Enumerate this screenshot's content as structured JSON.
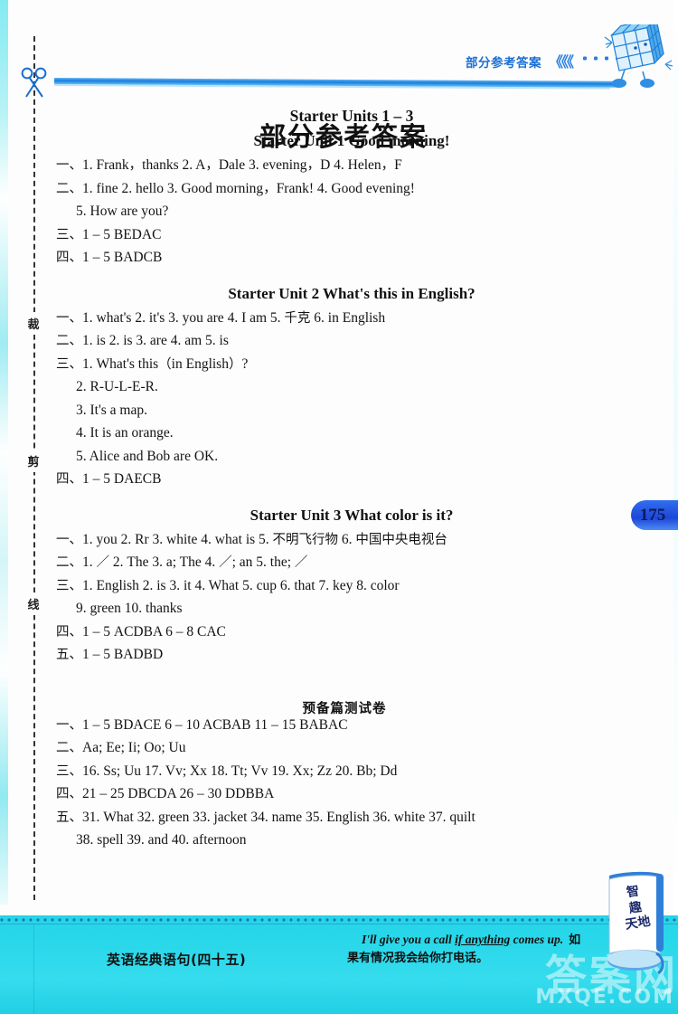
{
  "header": {
    "running_label": "部分参考答案",
    "chevrons": "《《《",
    "cube_icon": "rubiks-cube-mascot-icon"
  },
  "cut_line": {
    "scissors_icon": "scissors-icon",
    "chars": [
      "裁",
      "剪",
      "线"
    ]
  },
  "page": {
    "number": "175",
    "doc_title": "部分参考答案"
  },
  "sections": [
    {
      "id": "starter-units-1-3",
      "heading": "Starter Units 1 – 3",
      "heading_type": "units",
      "subsections": [
        {
          "id": "starter-unit-1",
          "heading": "Starter Unit 1    Good morning!",
          "lines": [
            {
              "text": "一、1. Frank，thanks   2. A，Dale  3. evening，D  4. Helen，F",
              "indent": false
            },
            {
              "text": "二、1. fine  2. hello  3. Good morning，Frank!    4. Good evening!",
              "indent": false
            },
            {
              "text": "5. How are you?",
              "indent": true
            },
            {
              "text": "三、1 – 5 BEDAC",
              "indent": false
            },
            {
              "text": "四、1 – 5 BADCB",
              "indent": false
            }
          ]
        },
        {
          "id": "starter-unit-2",
          "heading": "Starter Unit 2    What's this in English?",
          "lines": [
            {
              "text": "一、1. what's  2. it's  3. you are  4. I am  5. 千克  6. in English",
              "indent": false
            },
            {
              "text": "二、1. is  2. is  3. are  4. am  5. is",
              "indent": false
            },
            {
              "text": "三、1. What's this（in English）?",
              "indent": false
            },
            {
              "text": "2. R-U-L-E-R.",
              "indent": true
            },
            {
              "text": "3. It's a map.",
              "indent": true
            },
            {
              "text": "4. It is an orange.",
              "indent": true
            },
            {
              "text": "5. Alice and Bob are OK.",
              "indent": true
            },
            {
              "text": "四、1 – 5 DAECB",
              "indent": false
            }
          ]
        },
        {
          "id": "starter-unit-3",
          "heading": "Starter Unit 3    What color is it?",
          "lines": [
            {
              "text": "一、1. you  2. Rr  3. white  4. what is  5. 不明飞行物  6. 中国中央电视台",
              "indent": false
            },
            {
              "text": "二、1. ／  2. The  3. a; The  4. ／; an  5. the; ／",
              "indent": false
            },
            {
              "text": "三、1. English  2. is  3. it  4. What  5. cup  6. that  7. key  8. color",
              "indent": false
            },
            {
              "text": "9. green  10. thanks",
              "indent": true
            },
            {
              "text": "四、1 – 5 ACDBA   6 – 8 CAC",
              "indent": false
            },
            {
              "text": "五、1 – 5 BADBD",
              "indent": false
            }
          ]
        }
      ]
    },
    {
      "id": "preparation-test-paper",
      "heading": "预备篇测试卷",
      "heading_type": "chinese",
      "subsections": [
        {
          "id": "preparation-test-answers",
          "heading": "",
          "lines": [
            {
              "text": "一、1 – 5 BDACE   6 – 10 ACBAB   11 – 15 BABAC",
              "indent": false
            },
            {
              "text": "二、Aa; Ee; Ii; Oo; Uu",
              "indent": false
            },
            {
              "text": "三、16. Ss; Uu   17. Vv; Xx   18. Tt; Vv   19. Xx; Zz   20. Bb; Dd",
              "indent": false
            },
            {
              "text": "四、21 – 25 DBCDA   26 – 30 DDBBA",
              "indent": false
            },
            {
              "text": "五、31. What   32. green   33. jacket   34. name   35. English   36. white   37. quilt",
              "indent": false
            },
            {
              "text": "38. spell   39. and   40. afternoon",
              "indent": true
            }
          ]
        }
      ]
    }
  ],
  "footer": {
    "title": "英语经典语句(四十五)",
    "english": "I'll give you a call if anything comes up.",
    "english_underline": "if anything",
    "chinese": "如果有情况我会给你打电话。",
    "watermark_main": "答案网",
    "watermark_sub": "MXQE.COM",
    "scroll_icon": "scroll-mascot-icon",
    "scroll_text_lines": [
      "智",
      "趣",
      "天地"
    ]
  },
  "colors": {
    "accent_blue": "#1a7ede",
    "footer_cyan": "#2ad8ea",
    "page_tab": "#2f6ff0"
  }
}
